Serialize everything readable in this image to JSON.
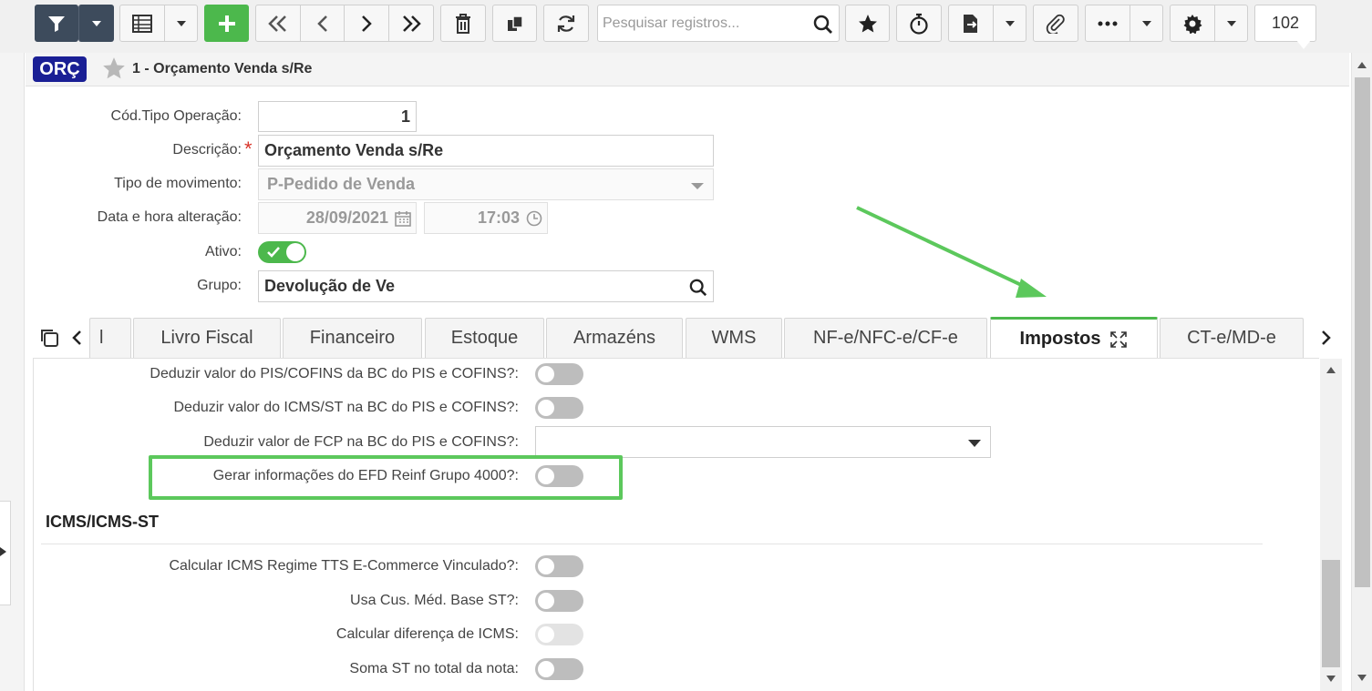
{
  "toolbar": {
    "search_placeholder": "Pesquisar registros...",
    "record_count": "102",
    "icons": [
      "filter-icon",
      "dropdown-icon",
      "grid-icon",
      "add-icon",
      "first-icon",
      "prev-icon",
      "next-icon",
      "last-icon",
      "trash-icon",
      "copy-icon",
      "refresh-icon",
      "search-icon",
      "star-icon",
      "stopwatch-icon",
      "export-icon",
      "attach-icon",
      "more-icon",
      "gear-icon"
    ]
  },
  "header": {
    "badge": "ORÇ",
    "title": "1 - Orçamento Venda s/Re"
  },
  "form": {
    "cod_tipo": {
      "label": "Cód.Tipo Operação:",
      "value": "1"
    },
    "descricao": {
      "label": "Descrição:",
      "required_mark": "*",
      "value": "Orçamento Venda s/Re"
    },
    "tipo_movimento": {
      "label": "Tipo de movimento:",
      "value": "P-Pedido de Venda"
    },
    "data_hora": {
      "label": "Data e hora alteração:",
      "date": "28/09/2021",
      "time": "17:03"
    },
    "ativo": {
      "label": "Ativo:",
      "on": true
    },
    "grupo": {
      "label": "Grupo:",
      "value": "Devolução de Ve"
    }
  },
  "tabs": [
    {
      "label": "l"
    },
    {
      "label": "Livro Fiscal"
    },
    {
      "label": "Financeiro"
    },
    {
      "label": "Estoque"
    },
    {
      "label": "Armazéns"
    },
    {
      "label": "WMS"
    },
    {
      "label": "NF-e/NFC-e/CF-e"
    },
    {
      "label": "Impostos",
      "active": true
    },
    {
      "label": "CT-e/MD-e"
    }
  ],
  "impostos": {
    "rows": [
      {
        "label": "Deduzir valor do PIS/COFINS da BC do PIS e COFINS?:",
        "type": "toggle"
      },
      {
        "label": "Deduzir valor do ICMS/ST na BC do PIS e COFINS?:",
        "type": "toggle"
      },
      {
        "label": "Deduzir valor de FCP na BC do PIS e COFINS?:",
        "type": "select",
        "value": ""
      },
      {
        "label": "Gerar informações do EFD Reinf Grupo 4000?:",
        "type": "toggle",
        "highlighted": true
      }
    ],
    "section_title": "ICMS/ICMS-ST",
    "icms_rows": [
      {
        "label": "Calcular ICMS Regime TTS E-Commerce Vinculado?:",
        "type": "toggle"
      },
      {
        "label": "Usa Cus. Méd. Base ST?:",
        "type": "toggle"
      },
      {
        "label": "Calcular diferença de ICMS:",
        "type": "toggle",
        "disabled": true
      },
      {
        "label": "Soma ST no total da nota:",
        "type": "toggle"
      }
    ]
  },
  "colors": {
    "accent_green": "#4cb84c",
    "badge_blue": "#1a1f95",
    "annotation_green": "#5cc85c",
    "required_red": "#d9352a"
  }
}
